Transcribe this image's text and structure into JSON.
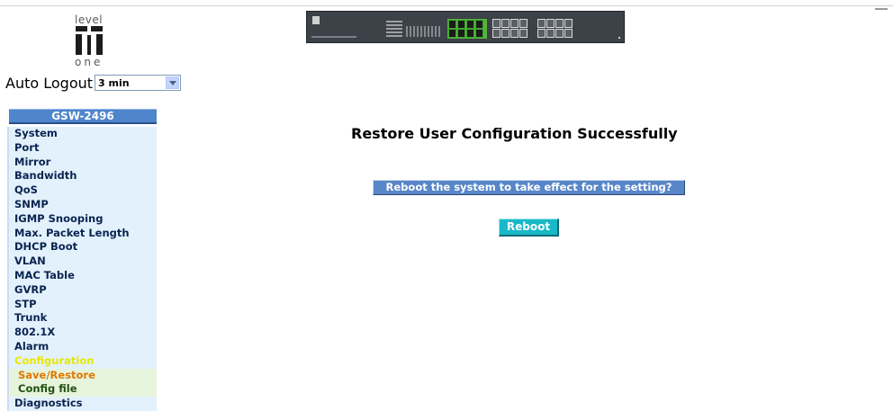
{
  "logo": {
    "line1": "level",
    "line2": "one"
  },
  "auto_logout": {
    "label": "Auto Logout",
    "selected": "3 min"
  },
  "sidebar": {
    "title": "GSW-2496",
    "items": [
      {
        "label": "System"
      },
      {
        "label": "Port"
      },
      {
        "label": "Mirror"
      },
      {
        "label": "Bandwidth"
      },
      {
        "label": "QoS"
      },
      {
        "label": "SNMP"
      },
      {
        "label": "IGMP Snooping"
      },
      {
        "label": "Max. Packet Length"
      },
      {
        "label": "DHCP Boot"
      },
      {
        "label": "VLAN"
      },
      {
        "label": "MAC Table"
      },
      {
        "label": "GVRP"
      },
      {
        "label": "STP"
      },
      {
        "label": "Trunk"
      },
      {
        "label": "802.1X"
      },
      {
        "label": "Alarm"
      },
      {
        "label": "Configuration"
      },
      {
        "label": "Save/Restore"
      },
      {
        "label": "Config file"
      },
      {
        "label": "Diagnostics"
      }
    ]
  },
  "main": {
    "heading": "Restore User Configuration Successfully",
    "prompt": "Reboot the system to take effect for the setting?",
    "reboot_label": "Reboot"
  },
  "colors": {
    "menu_title_bg": "#4f85cb",
    "menu_item_bg": "#e3f1fc",
    "active_text": "#e8e800",
    "current_sub_text": "#e07800",
    "reboot_bg": "#19b8c8"
  }
}
